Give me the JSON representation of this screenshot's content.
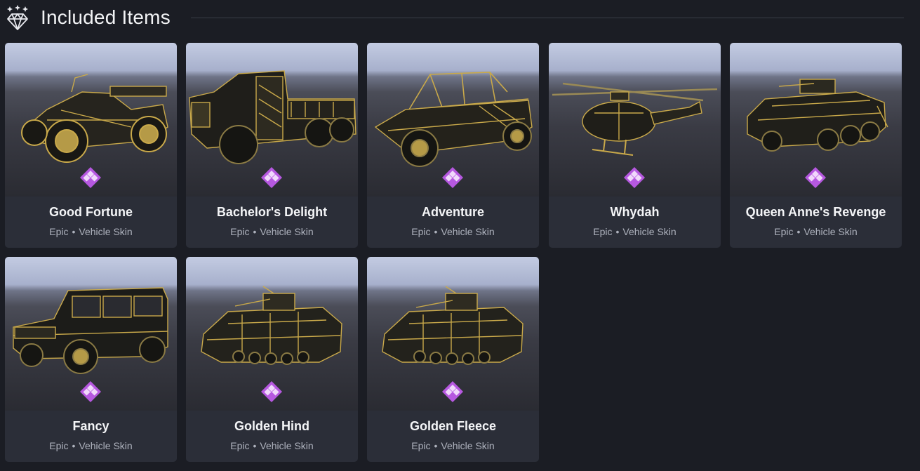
{
  "header": {
    "title": "Included Items",
    "icon": "diamond-gem-icon"
  },
  "colors": {
    "background": "#1b1d24",
    "card": "#2b2e38",
    "rarity_epic": "#b658e0",
    "gold": "#c9a94a"
  },
  "items": [
    {
      "name": "Good Fortune",
      "rarity": "Epic",
      "separator": "•",
      "type": "Vehicle Skin",
      "vehicle": "quad-bike"
    },
    {
      "name": "Bachelor's Delight",
      "rarity": "Epic",
      "separator": "•",
      "type": "Vehicle Skin",
      "vehicle": "truck"
    },
    {
      "name": "Adventure",
      "rarity": "Epic",
      "separator": "•",
      "type": "Vehicle Skin",
      "vehicle": "buggy"
    },
    {
      "name": "Whydah",
      "rarity": "Epic",
      "separator": "•",
      "type": "Vehicle Skin",
      "vehicle": "helicopter"
    },
    {
      "name": "Queen Anne's Revenge",
      "rarity": "Epic",
      "separator": "•",
      "type": "Vehicle Skin",
      "vehicle": "apc"
    },
    {
      "name": "Fancy",
      "rarity": "Epic",
      "separator": "•",
      "type": "Vehicle Skin",
      "vehicle": "suv"
    },
    {
      "name": "Golden Hind",
      "rarity": "Epic",
      "separator": "•",
      "type": "Vehicle Skin",
      "vehicle": "ifv"
    },
    {
      "name": "Golden Fleece",
      "rarity": "Epic",
      "separator": "•",
      "type": "Vehicle Skin",
      "vehicle": "ifv"
    }
  ]
}
